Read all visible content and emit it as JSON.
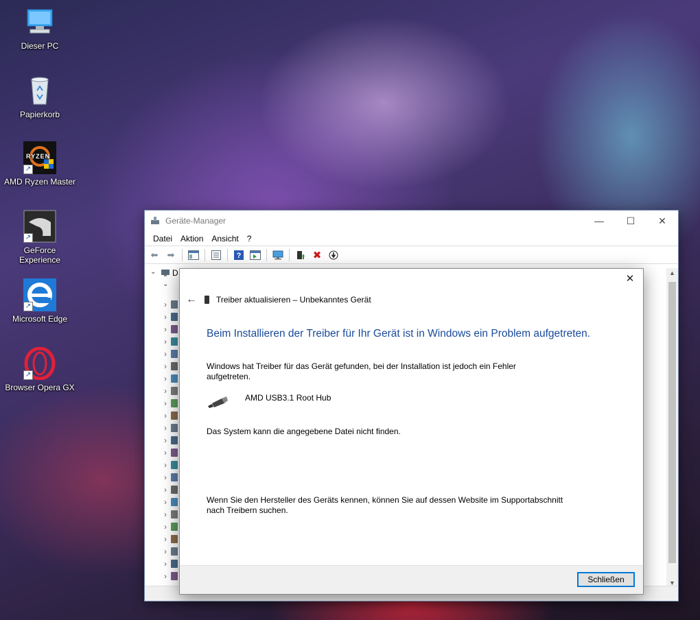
{
  "desktop": {
    "icons": [
      {
        "label": "Dieser PC",
        "icon": "computer-icon"
      },
      {
        "label": "Papierkorb",
        "icon": "recycle-bin-icon"
      },
      {
        "label": "AMD Ryzen Master",
        "icon": "ryzen-master-icon",
        "badge": "RYZEN"
      },
      {
        "label": "GeForce Experience",
        "icon": "geforce-icon"
      },
      {
        "label": "Microsoft Edge",
        "icon": "edge-icon"
      },
      {
        "label": "Browser Opera GX",
        "icon": "opera-gx-icon"
      }
    ]
  },
  "device_manager": {
    "title": "Geräte-Manager",
    "menu": [
      "Datei",
      "Aktion",
      "Ansicht",
      "?"
    ],
    "root_label_fragment": "D",
    "window_controls": {
      "minimize": "—",
      "maximize": "☐",
      "close": "✕"
    }
  },
  "dialog": {
    "title": "Treiber aktualisieren – Unbekanntes Gerät",
    "heading": "Beim Installieren der Treiber für Ihr Gerät ist in Windows ein Problem aufgetreten.",
    "message_line1": "Windows hat Treiber für das Gerät gefunden, bei der Installation ist jedoch ein Fehler",
    "message_line2": "aufgetreten.",
    "device_name": "AMD USB3.1 Root Hub",
    "error_text": "Das System kann die angegebene Datei nicht finden.",
    "hint_line1": "Wenn Sie den Hersteller des Geräts kennen, können Sie auf dessen Website im Supportabschnitt",
    "hint_line2": "nach Treibern suchen.",
    "close_button": "Schließen",
    "close_glyph": "✕",
    "back_glyph": "←"
  },
  "colors": {
    "heading_blue": "#1a4a9a",
    "button_border": "#0078d7"
  }
}
